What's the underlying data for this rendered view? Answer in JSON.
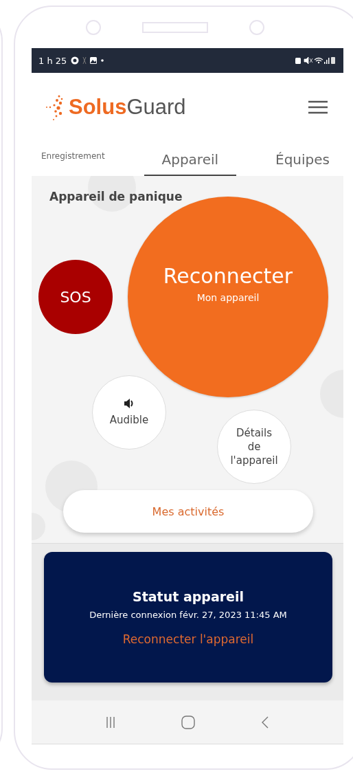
{
  "status_bar": {
    "time": "1 h 25"
  },
  "header": {
    "logo_part1": "Solus",
    "logo_part2": "Guard"
  },
  "tabs": [
    {
      "label": "Enregistrement",
      "selected": false
    },
    {
      "label": "Appareil",
      "selected": true
    },
    {
      "label": "Équipes",
      "selected": false
    }
  ],
  "panel": {
    "title": "Appareil de panique",
    "sos_button": {
      "label": "SOS"
    },
    "reconnect_button": {
      "label": "Reconnecter",
      "sublabel": "Mon appareil"
    },
    "audible_button": {
      "label": "Audible"
    },
    "details_button": {
      "label": "Détails de l'appareil"
    },
    "activities_button": {
      "label": "Mes activités"
    }
  },
  "status_card": {
    "title": "Statut appareil",
    "last_connection": "Dernière connexion févr. 27, 2023 11:45 AM",
    "link": "Reconnecter l'appareil"
  }
}
